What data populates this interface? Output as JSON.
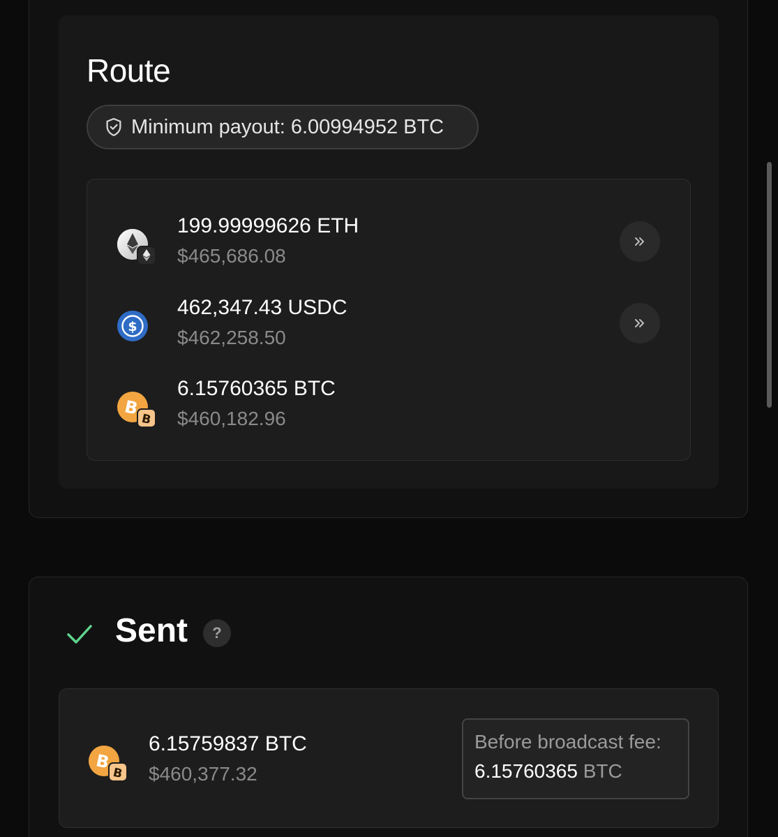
{
  "route": {
    "title": "Route",
    "min_payout": "Minimum payout: 6.00994952 BTC",
    "hops": [
      {
        "amount": "199.99999626 ETH",
        "usd": "$465,686.08",
        "icon": "eth-icon",
        "has_arrow": true
      },
      {
        "amount": "462,347.43 USDC",
        "usd": "$462,258.50",
        "icon": "usdc-icon",
        "has_arrow": true
      },
      {
        "amount": "6.15760365 BTC",
        "usd": "$460,182.96",
        "icon": "btc-icon",
        "has_arrow": false
      }
    ]
  },
  "sent": {
    "title": "Sent",
    "help": "?",
    "amount": "6.15759837 BTC",
    "usd": "$460,377.32",
    "fee_label": "Before broadcast fee:",
    "fee_value": "6.15760365",
    "fee_unit": "BTC"
  },
  "colors": {
    "background": "#0b0b0b",
    "panel": "#1d1d1d",
    "check_green": "#5fd38d",
    "usdc_blue": "#2f6cc5",
    "btc_orange": "#f2a541"
  }
}
